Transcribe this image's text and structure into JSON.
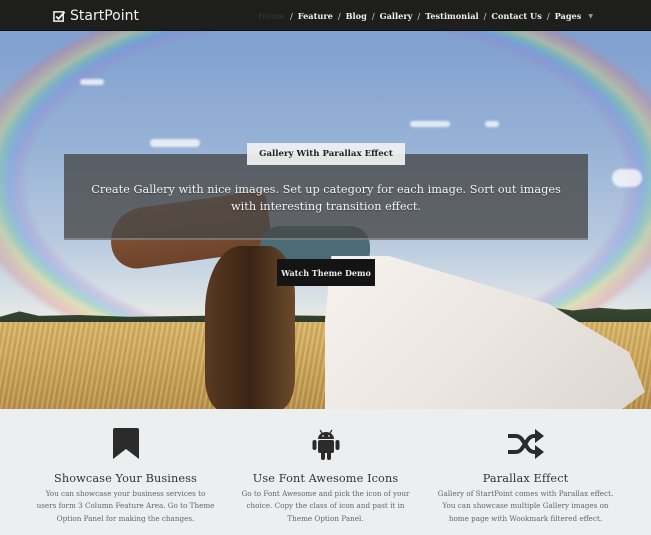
{
  "header": {
    "logo_text": "StartPoint",
    "logo_icon": "checkbox-icon",
    "nav": [
      {
        "label": "Home",
        "active": true
      },
      {
        "label": "Feature"
      },
      {
        "label": "Blog"
      },
      {
        "label": "Gallery"
      },
      {
        "label": "Testimonial"
      },
      {
        "label": "Contact Us"
      },
      {
        "label": "Pages",
        "dropdown": true
      }
    ],
    "separator": "/"
  },
  "hero": {
    "tag": "Gallery With Parallax Effect",
    "text": "Create Gallery with nice images. Set up category for each image. Sort out images with interesting transition effect.",
    "button_label": "Watch Theme Demo"
  },
  "features": [
    {
      "icon": "bookmark-icon",
      "title": "Showcase Your Business",
      "text": "You can showcase your business services to users form 3 Column Feature Area. Go to Theme Option Panel for making the changes."
    },
    {
      "icon": "android-icon",
      "title": "Use Font Awesome Icons",
      "text": "Go to Font Awesome and pick the icon of your choice. Copy the class of icon and past it in Theme Option Panel."
    },
    {
      "icon": "shuffle-icon",
      "title": "Parallax Effect",
      "text": "Gallery of StartPoint comes with Parallax effect. You can showcase multiple Gallery images on home page with Wookmark filtered effect."
    }
  ],
  "colors": {
    "header_bg": "#1e1e1c",
    "features_bg": "#eceeef",
    "button_bg": "#141414",
    "icon_color": "#2b2b2b"
  }
}
